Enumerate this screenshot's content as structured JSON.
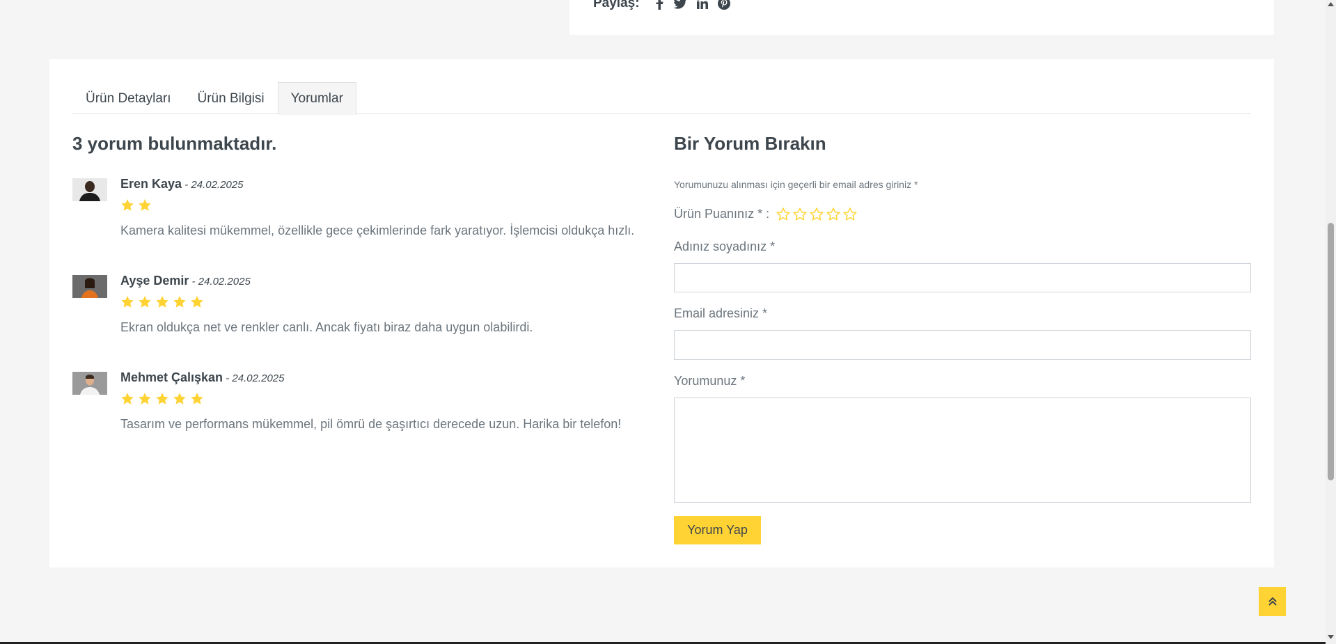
{
  "share": {
    "label": "Paylaş:",
    "icons": [
      "facebook-icon",
      "twitter-icon",
      "linkedin-icon",
      "pinterest-icon"
    ]
  },
  "tabs": [
    {
      "label": "Ürün Detayları",
      "active": false
    },
    {
      "label": "Ürün Bilgisi",
      "active": false
    },
    {
      "label": "Yorumlar",
      "active": true
    }
  ],
  "reviews": {
    "title": "3 yorum bulunmaktadır.",
    "items": [
      {
        "name": "Eren Kaya",
        "date": " - 24.02.2025",
        "rating": 2,
        "text": "Kamera kalitesi mükemmel, özellikle gece çekimlerinde fark yaratıyor. İşlemcisi oldukça hızlı."
      },
      {
        "name": "Ayşe Demir",
        "date": " - 24.02.2025",
        "rating": 5,
        "text": "Ekran oldukça net ve renkler canlı. Ancak fiyatı biraz daha uygun olabilirdi."
      },
      {
        "name": "Mehmet Çalışkan",
        "date": " - 24.02.2025",
        "rating": 5,
        "text": "Tasarım ve performans mükemmel, pil ömrü de şaşırtıcı derecede uzun. Harika bir telefon!"
      }
    ]
  },
  "form": {
    "title": "Bir Yorum Bırakın",
    "note": "Yorumunuzu alınması için geçerli bir email adres giriniz *",
    "rating_label": "Ürün Puanınız * :",
    "rating_value": 0,
    "rating_max": 5,
    "name_label": "Adınız soyadınız *",
    "name_value": "",
    "email_label": "Email adresiniz *",
    "email_value": "",
    "comment_label": "Yorumunuz *",
    "comment_value": "",
    "submit_label": "Yorum Yap"
  },
  "colors": {
    "accent": "#ffd333",
    "text": "#3d464d",
    "muted": "#6c757d",
    "background": "#f5f5f5"
  }
}
